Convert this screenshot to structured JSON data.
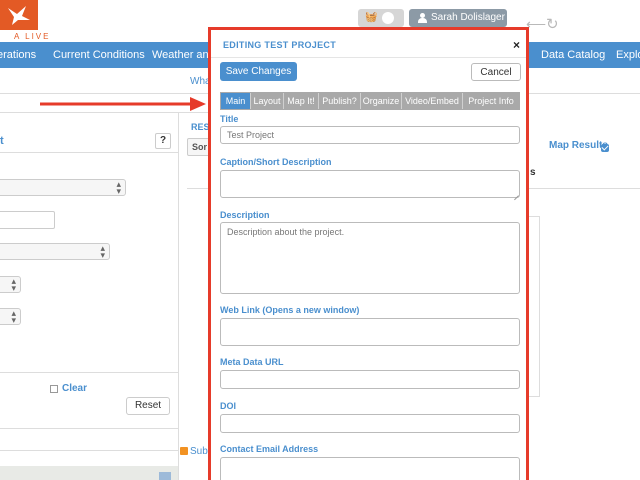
{
  "header": {
    "logo_text": "A LIVE",
    "user_name": "Sarah Dolislager",
    "cart_icon": "basket-icon",
    "back_icon": "arrow-left-icon",
    "refresh_icon": "refresh-icon"
  },
  "nav": {
    "items": [
      "erations",
      "Current Conditions",
      "Weather and T",
      "Data Catalog",
      "Explo"
    ]
  },
  "background": {
    "subtab": "Wha",
    "results_label": "RES",
    "sort_label": "Sor",
    "map_results_label": "Map Results",
    "s_fragment": "s",
    "left_title": "t",
    "help_label": "?",
    "clear_label": "Clear",
    "reset_label": "Reset",
    "subscribe_label": "Sub"
  },
  "modal": {
    "title": "EDITING TEST PROJECT",
    "close_label": "×",
    "save_label": "Save Changes",
    "cancel_label": "Cancel",
    "tabs": [
      "Main",
      "Layout",
      "Map It!",
      "Publish?",
      "Organize",
      "Video/Embed",
      "Project Info"
    ],
    "active_tab": "Main",
    "fields": {
      "title_label": "Title",
      "title_value": "Test Project",
      "caption_label": "Caption/Short Description",
      "caption_value": "",
      "description_label": "Description",
      "description_value": "Description about the project.",
      "weblink_label": "Web Link (Opens a new window)",
      "weblink_value": "",
      "metadata_label": "Meta Data URL",
      "metadata_value": "",
      "doi_label": "DOI",
      "doi_value": "",
      "contact_label": "Contact Email Address",
      "contact_value": ""
    }
  },
  "colors": {
    "accent_blue": "#4a8fce",
    "highlight_red": "#e63b2a",
    "logo_orange": "#e35a25"
  }
}
